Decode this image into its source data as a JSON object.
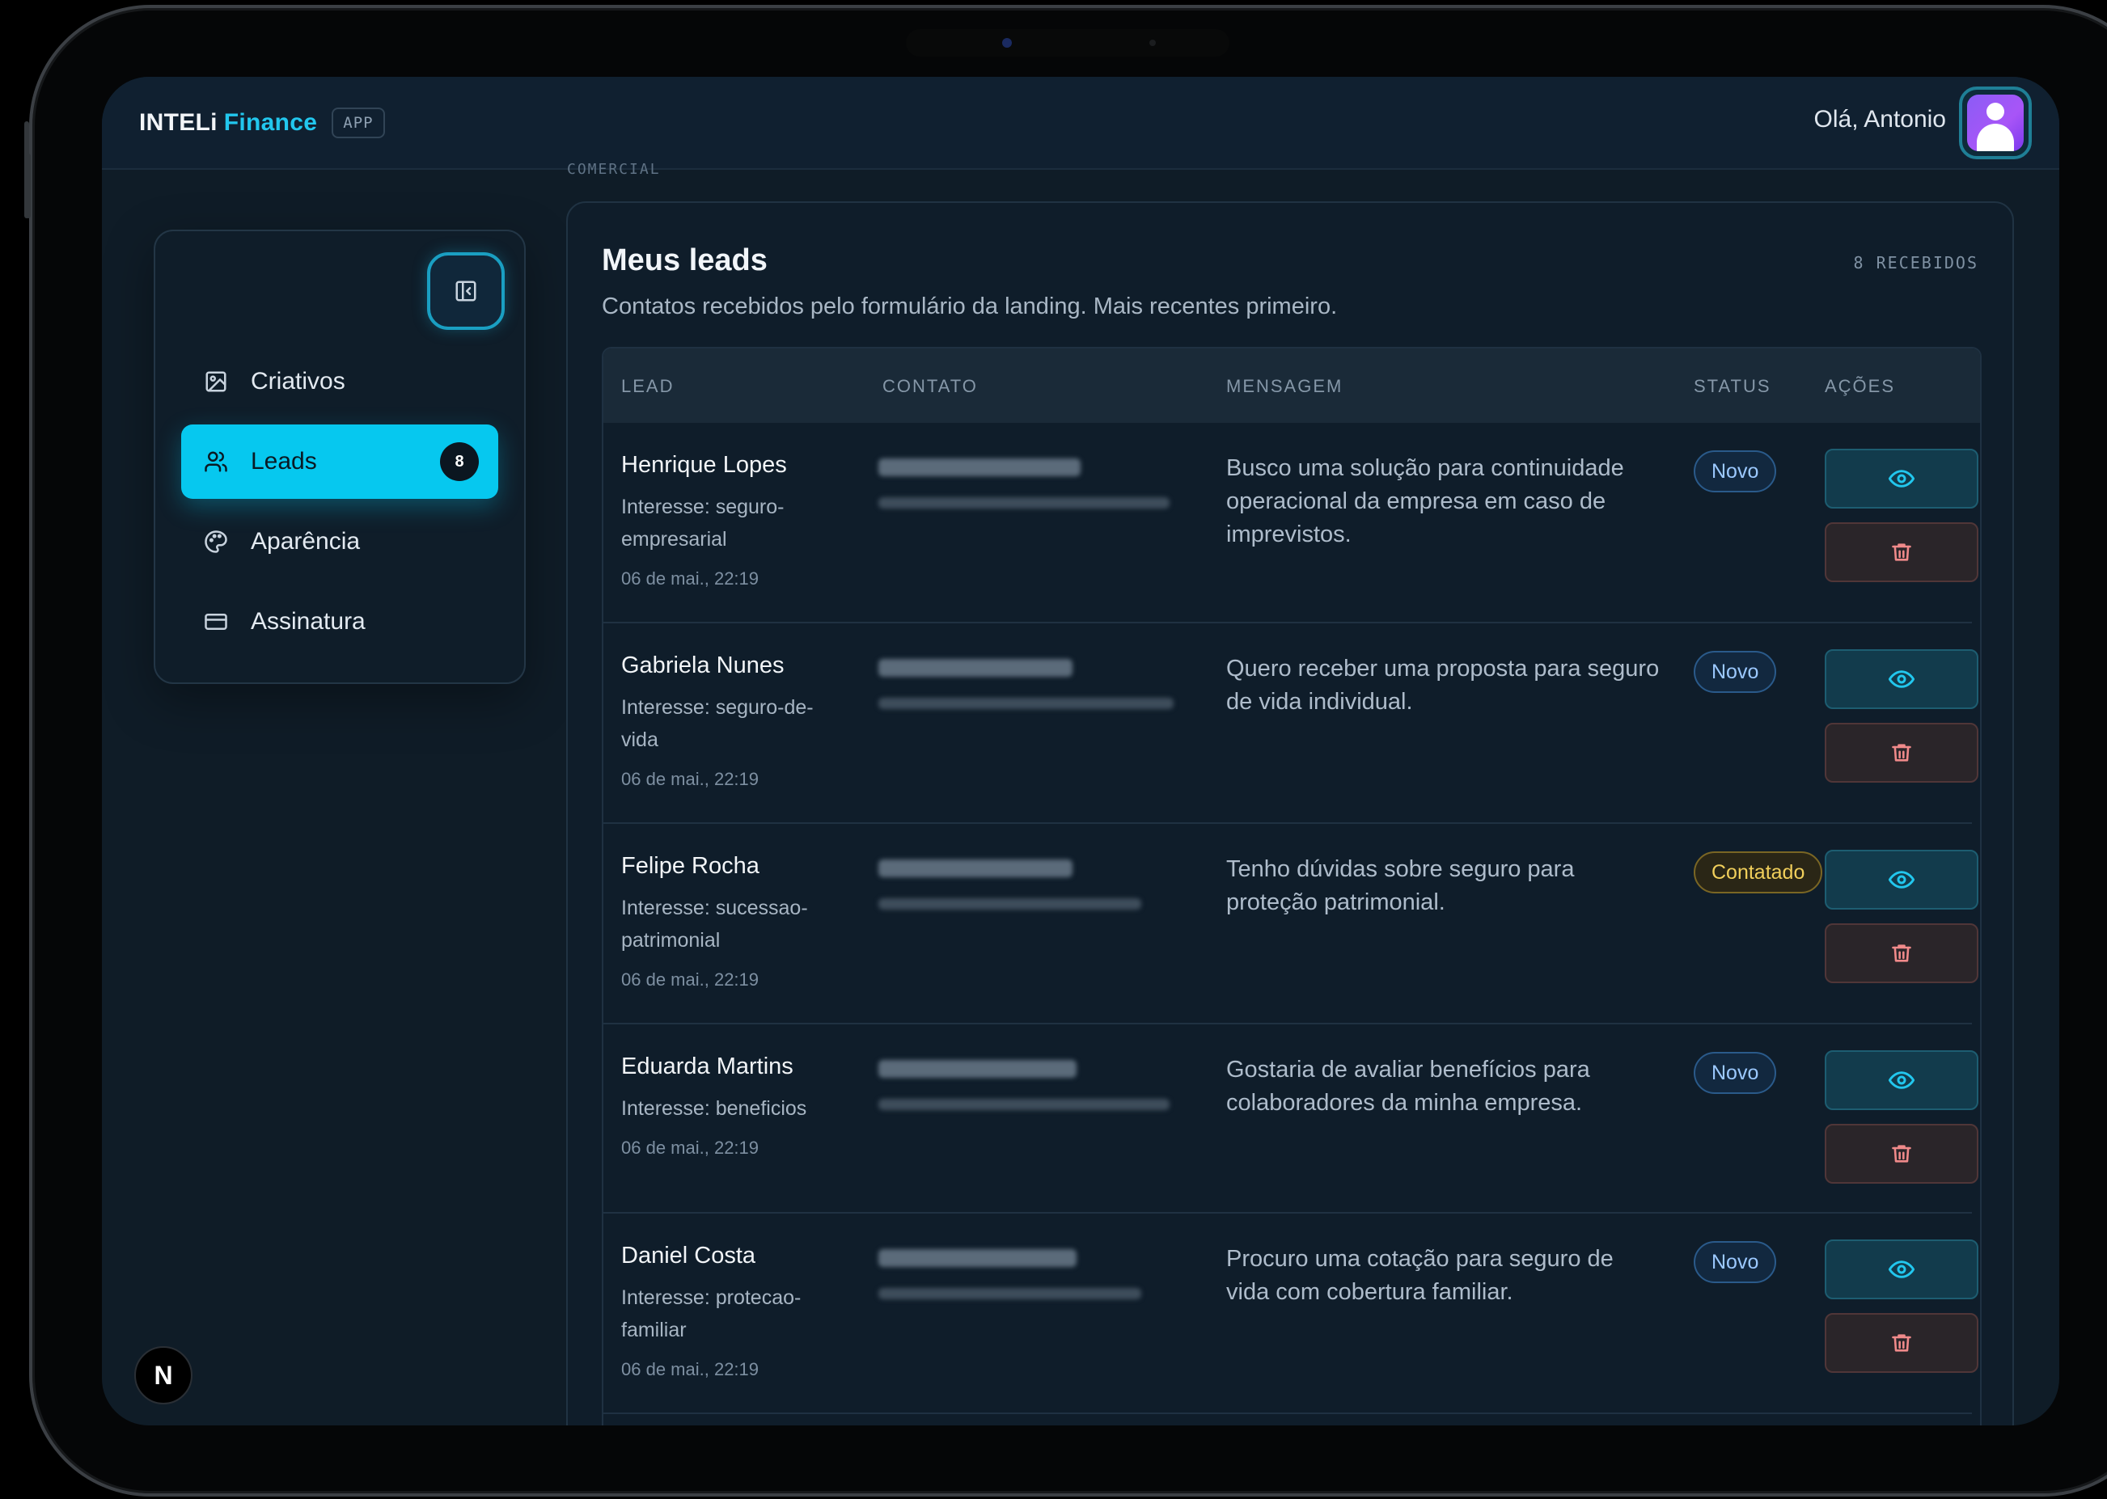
{
  "app": {
    "brand_main": "INTELi",
    "brand_accent": "Finance",
    "brand_tag": "APP",
    "greeting": "Olá, Antonio",
    "accent_color": "#06c8ef"
  },
  "breadcrumb": "COMERCIAL",
  "sidebar": {
    "items": [
      {
        "label": "Criativos",
        "icon": "image-icon"
      },
      {
        "label": "Leads",
        "icon": "users-icon",
        "badge": "8",
        "active": true
      },
      {
        "label": "Aparência",
        "icon": "palette-icon"
      },
      {
        "label": "Assinatura",
        "icon": "credit-card-icon"
      }
    ],
    "footer_logo": "N"
  },
  "card": {
    "title": "Meus leads",
    "subtitle": "Contatos recebidos pelo formulário da landing. Mais recentes primeiro.",
    "count": "8 RECEBIDOS"
  },
  "table": {
    "headers": {
      "lead": "LEAD",
      "contato": "CONTATO",
      "mensagem": "MENSAGEM",
      "status": "STATUS",
      "acoes": "AÇÕES"
    },
    "rows": [
      {
        "name": "Henrique Lopes",
        "interest": "Interesse: seguro-empresarial",
        "date": "06 de mai., 22:19",
        "message": "Busco uma solução para continuidade operacional da empresa em caso de imprevistos.",
        "status": "Novo"
      },
      {
        "name": "Gabriela Nunes",
        "interest": "Interesse: seguro-de-vida",
        "date": "06 de mai., 22:19",
        "message": "Quero receber uma proposta para seguro de vida individual.",
        "status": "Novo"
      },
      {
        "name": "Felipe Rocha",
        "interest": "Interesse: sucessao-patrimonial",
        "date": "06 de mai., 22:19",
        "message": "Tenho dúvidas sobre seguro para proteção patrimonial.",
        "status": "Contatado"
      },
      {
        "name": "Eduarda Martins",
        "interest": "Interesse: beneficios",
        "date": "06 de mai., 22:19",
        "message": "Gostaria de avaliar benefícios para colaboradores da minha empresa.",
        "status": "Novo"
      },
      {
        "name": "Daniel Costa",
        "interest": "Interesse: protecao-familiar",
        "date": "06 de mai., 22:19",
        "message": "Procuro uma cotação para seguro de vida com cobertura familiar.",
        "status": "Novo"
      }
    ]
  }
}
